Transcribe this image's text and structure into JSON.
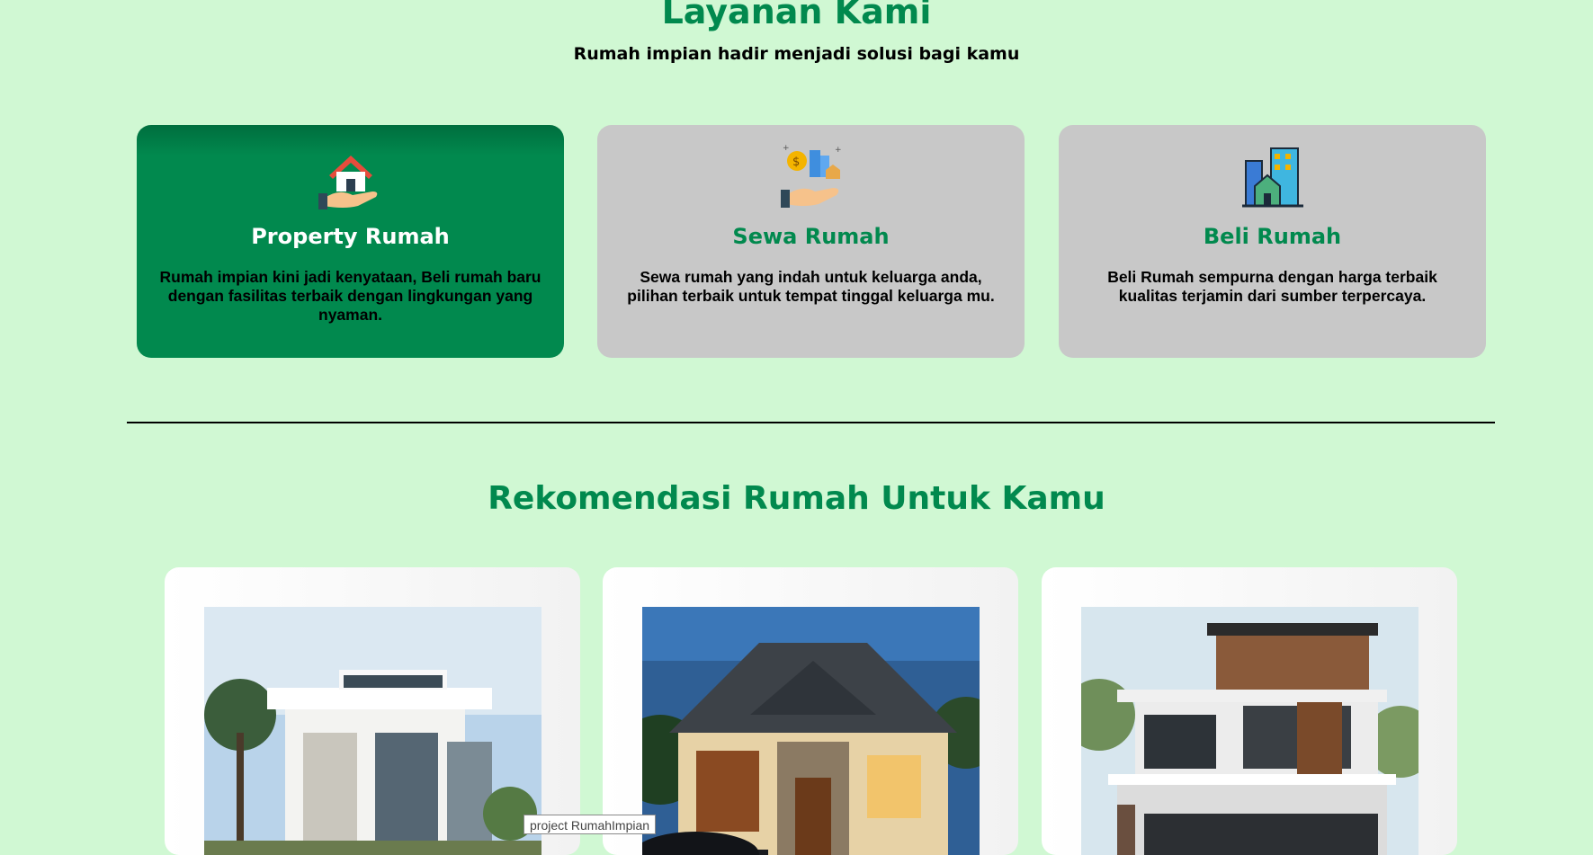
{
  "services": {
    "title": "Layanan Kami",
    "subtitle": "Rumah impian hadir menjadi solusi bagi kamu",
    "cards": [
      {
        "icon": "house-in-hand-icon",
        "title": "Property Rumah",
        "description": "Rumah impian kini jadi kenyataan, Beli rumah baru dengan fasilitas terbaik dengan lingkungan yang nyaman.",
        "active": true
      },
      {
        "icon": "money-property-hand-icon",
        "title": "Sewa Rumah",
        "description": "Sewa rumah yang indah untuk keluarga anda, pilihan terbaik untuk tempat tinggal keluarga mu.",
        "active": false
      },
      {
        "icon": "city-buildings-icon",
        "title": "Beli Rumah",
        "description": "Beli Rumah sempurna dengan harga terbaik kualitas terjamin dari sumber terpercaya.",
        "active": false
      }
    ]
  },
  "recommendations": {
    "title": "Rekomendasi Rumah Untuk Kamu",
    "houses": [
      {
        "photo": "modern-white-house-photo"
      },
      {
        "photo": "single-storey-house-photo"
      },
      {
        "photo": "multi-storey-modern-house-photo"
      }
    ]
  },
  "tooltip": {
    "text": "project RumahImpian"
  },
  "colors": {
    "background": "#d0f8d3",
    "accent": "#01894e",
    "card_inactive": "#c8c8c8",
    "card_white": "#ffffff"
  }
}
